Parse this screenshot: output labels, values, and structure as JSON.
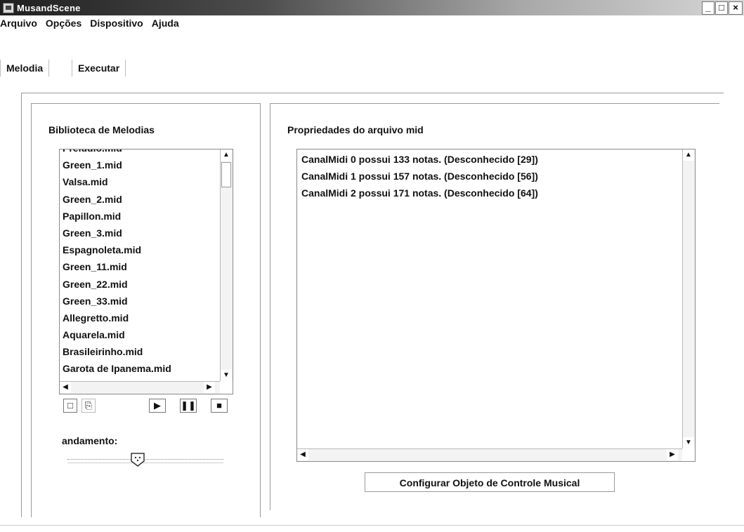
{
  "window": {
    "title": "MusandScene"
  },
  "menu": {
    "items": [
      "Arquivo",
      "Opções",
      "Dispositivo",
      "Ajuda"
    ]
  },
  "tabs": [
    "Melodia",
    "Executar"
  ],
  "library": {
    "title": "Biblioteca de Melodias",
    "partial_item": "Prelúdio.mid",
    "items": [
      "Green_1.mid",
      "Valsa.mid",
      "Green_2.mid",
      "Papillon.mid",
      "Green_3.mid",
      "Espagnoleta.mid",
      "Green_11.mid",
      "Green_22.mid",
      "Green_33.mid",
      "Allegretto.mid",
      "Aquarela.mid",
      "Brasileirinho.mid",
      "Garota de Ipanema.mid"
    ]
  },
  "tempo": {
    "label": "andamento:",
    "level": 0.45
  },
  "properties": {
    "title": "Propriedades do arquivo mid",
    "lines": [
      "CanalMidi 0 possui 133 notas. (Desconhecido [29])",
      "CanalMidi 1 possui 157 notas. (Desconhecido [56])",
      "CanalMidi 2 possui 171 notas. (Desconhecido [64])"
    ]
  },
  "config_button": {
    "label": "Configurar Objeto de Controle Musical"
  },
  "icons": {
    "app": "app-icon",
    "minimize": "minimize-icon",
    "maximize": "maximize-icon",
    "close": "close-icon",
    "new": "new-file-icon",
    "open": "open-folder-icon",
    "play": "play-icon",
    "pause": "pause-icon",
    "stop": "stop-icon"
  }
}
